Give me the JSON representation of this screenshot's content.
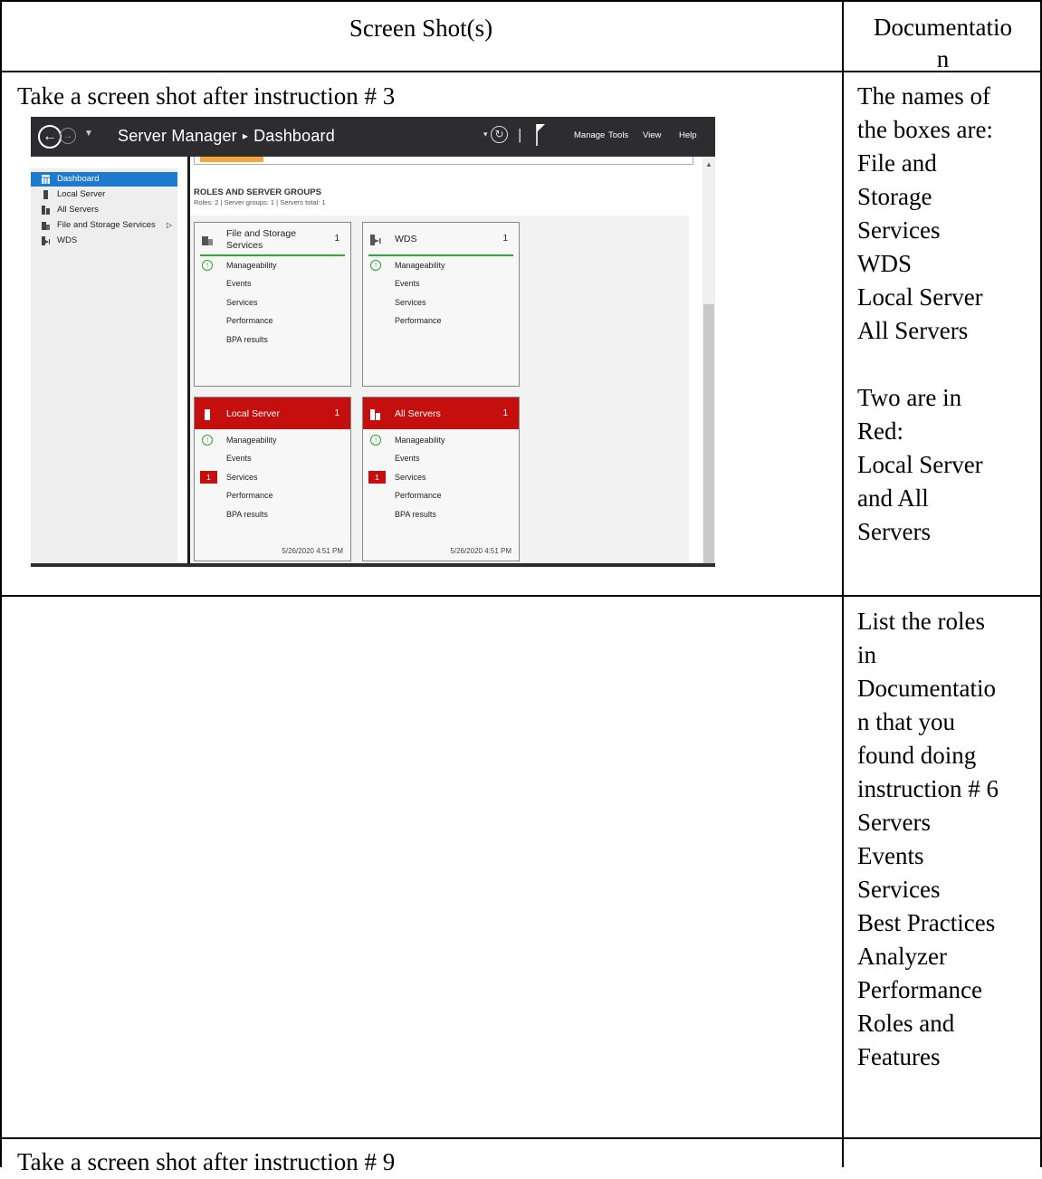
{
  "table": {
    "header": {
      "screenshots": "Screen Shot(s)",
      "documentation": "Documentatio n"
    },
    "row1": {
      "instruction": "Take a screen shot after instruction # 3",
      "doc_lines": [
        "The names of",
        "the boxes are:",
        "File and",
        "Storage",
        "Services",
        "WDS",
        "Local Server",
        "All Servers",
        "",
        "Two are in",
        "Red:",
        "Local Server",
        "and All",
        "Servers"
      ]
    },
    "row2": {
      "doc_lines": [
        "List the roles",
        "in",
        "Documentatio",
        "n that you",
        "found doing",
        "instruction # 6",
        "Servers",
        "Events",
        "Services",
        "Best Practices",
        "Analyzer",
        "Performance",
        "Roles and",
        "Features"
      ]
    },
    "row3": {
      "instruction": "Take a screen shot after instruction # 9"
    }
  },
  "server_manager": {
    "title": "Server Manager",
    "breadcrumb": "Dashboard",
    "separator": "▸",
    "menu": [
      "Manage",
      "Tools",
      "View",
      "Help"
    ],
    "nav": [
      {
        "label": "Dashboard",
        "icon": "dashboard-icon",
        "active": true
      },
      {
        "label": "Local Server",
        "icon": "server-icon"
      },
      {
        "label": "All Servers",
        "icon": "servers-icon"
      },
      {
        "label": "File and Storage Services",
        "icon": "storage-icon"
      },
      {
        "label": "WDS",
        "icon": "wds-icon"
      }
    ],
    "section_title": "ROLES AND SERVER GROUPS",
    "section_sub": "Roles: 2   |   Server groups: 1   |   Servers total: 1",
    "tiles": [
      {
        "name": "File and Storage Services",
        "name_l1": "File and Storage",
        "name_l2": "Services",
        "count": "1",
        "rows": [
          "Manageability",
          "Events",
          "Services",
          "Performance",
          "BPA results"
        ]
      },
      {
        "name": "WDS",
        "count": "1",
        "rows": [
          "Manageability",
          "Events",
          "Services",
          "Performance"
        ]
      },
      {
        "name": "Local Server",
        "count": "1",
        "status": "red",
        "services_badge": "1",
        "rows": [
          "Manageability",
          "Events",
          "Services",
          "Performance",
          "BPA results"
        ],
        "timestamp": "5/26/2020 4:51 PM"
      },
      {
        "name": "All Servers",
        "count": "1",
        "status": "red",
        "services_badge": "1",
        "rows": [
          "Manageability",
          "Events",
          "Services",
          "Performance",
          "BPA results"
        ],
        "timestamp": "5/26/2020 4:51 PM"
      }
    ],
    "colors": {
      "titlebar": "#2d2d30",
      "accent_blue": "#1e7acd",
      "alert_red": "#c50f0f",
      "ok_green": "#2ba52b",
      "welcome_orange": "#f4a83c"
    }
  }
}
